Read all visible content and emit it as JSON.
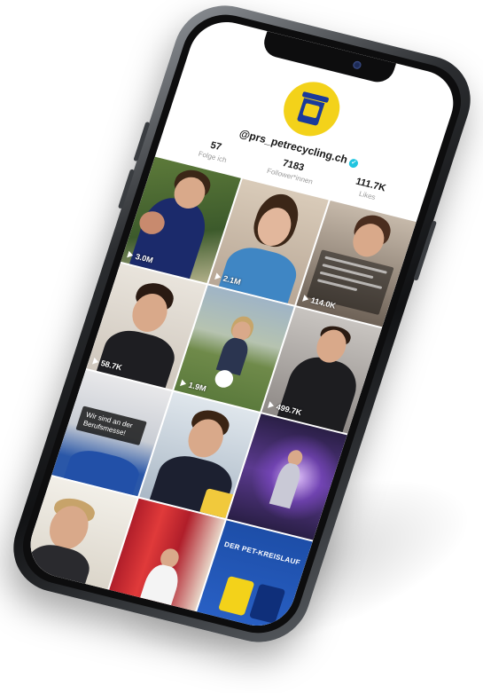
{
  "profile": {
    "username": "@prs_petrecycling.ch",
    "verified_glyph": "✓",
    "stats": [
      {
        "value": "57",
        "label": "Folge ich"
      },
      {
        "value": "7183",
        "label": "Follower*innen"
      },
      {
        "value": "111.7K",
        "label": "Likes"
      }
    ],
    "avatar_icon": "recycling-bin-logo"
  },
  "videos": [
    {
      "views": "3.0M"
    },
    {
      "views": "2.1M"
    },
    {
      "views": "114.0K"
    },
    {
      "views": "58.7K"
    },
    {
      "views": "1.9M"
    },
    {
      "views": "499.7K"
    },
    {
      "views": "",
      "caption": "Wir sind an der Berufsmesse!"
    },
    {
      "views": ""
    },
    {
      "views": ""
    },
    {
      "views": ""
    },
    {
      "views": ""
    },
    {
      "views": "",
      "banner": "DER PET-KREISLAUF"
    }
  ],
  "colors": {
    "avatar_bg": "#f3d21a",
    "brand_blue": "#1a3a9a",
    "verified": "#20c5e0"
  }
}
